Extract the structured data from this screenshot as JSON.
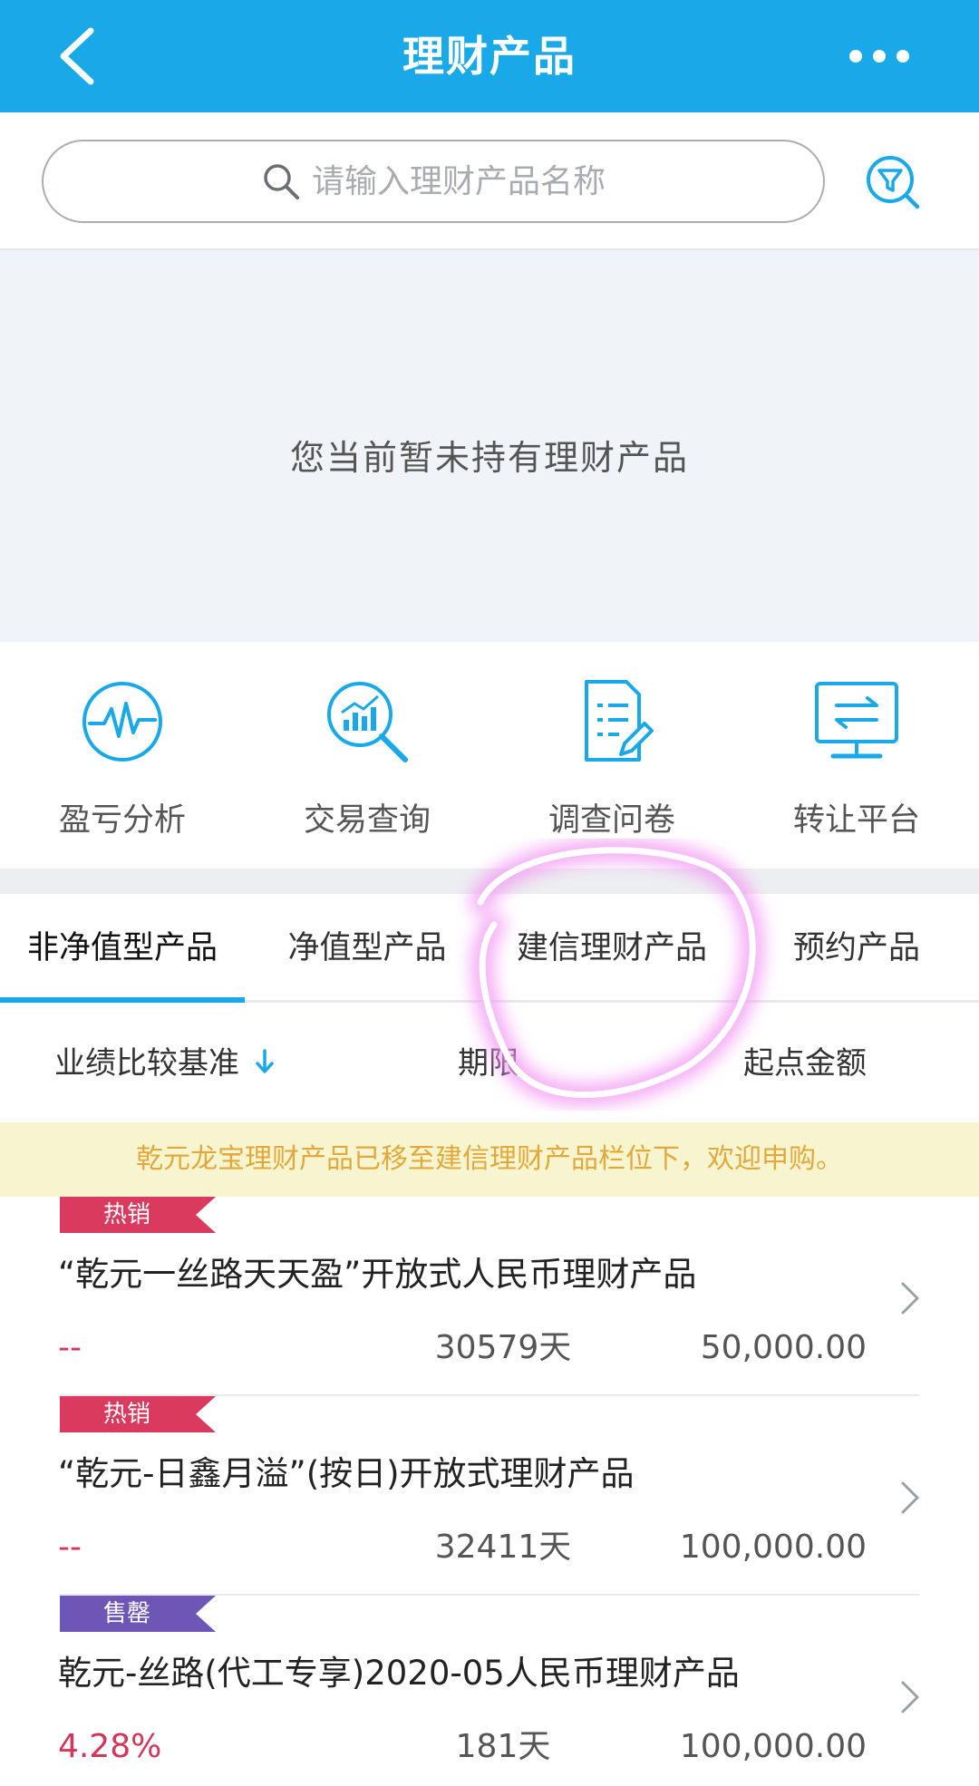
{
  "header": {
    "title": "理财产品",
    "back_icon": "chevron-left-icon",
    "more_icon": "more-dots-icon"
  },
  "search": {
    "placeholder": "请输入理财产品名称",
    "value": "",
    "filter_icon": "filter-search-icon"
  },
  "holdings": {
    "empty_text": "您当前暂未持有理财产品"
  },
  "actions": [
    {
      "label": "盈亏分析",
      "icon": "pulse-icon"
    },
    {
      "label": "交易查询",
      "icon": "chart-magnifier-icon"
    },
    {
      "label": "调查问卷",
      "icon": "questionnaire-icon"
    },
    {
      "label": "转让平台",
      "icon": "transfer-monitor-icon"
    }
  ],
  "tabs": [
    {
      "label": "非净值型产品",
      "active": true
    },
    {
      "label": "净值型产品",
      "active": false
    },
    {
      "label": "建信理财产品",
      "active": false
    },
    {
      "label": "预约产品",
      "active": false
    }
  ],
  "sort": {
    "benchmark": "业绩比较基准",
    "term": "期限",
    "min_amount": "起点金额"
  },
  "notice": "乾元龙宝理财产品已移至建信理财产品栏位下，欢迎申购。",
  "products": [
    {
      "badge": "热销",
      "badge_color": "#d93a5e",
      "name": "“乾元一丝路天天盈”开放式人民币理财产品",
      "rate": "--",
      "term": "30579天",
      "amount": "50,000.00"
    },
    {
      "badge": "热销",
      "badge_color": "#d93a5e",
      "name": "“乾元-日鑫月溢”(按日)开放式理财产品",
      "rate": "--",
      "term": "32411天",
      "amount": "100,000.00"
    },
    {
      "badge": "售罄",
      "badge_color": "#6e56b6",
      "name": "乾元-丝路(代工专享)2020-05人民币理财产品",
      "rate": "4.28%",
      "term": "181天",
      "amount": "100,000.00"
    }
  ],
  "colors": {
    "primary": "#1aa9e8",
    "accent_red": "#d3365a",
    "notice_text": "#e3a83b",
    "annotation": "#f07cf0"
  }
}
